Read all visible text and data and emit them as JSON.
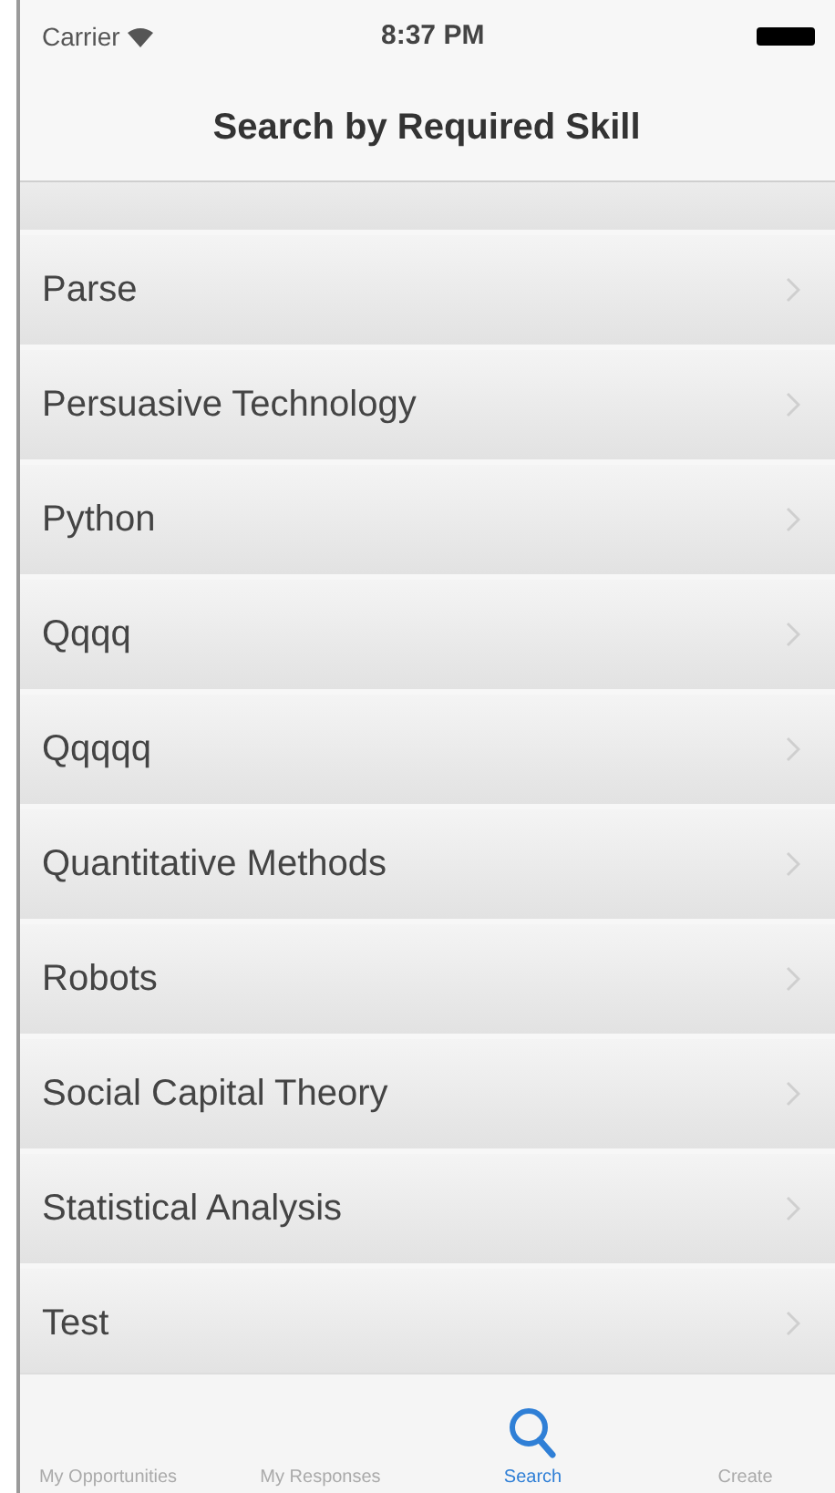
{
  "status_bar": {
    "carrier": "Carrier",
    "time": "8:37 PM"
  },
  "navigation_bar": {
    "title": "Search by Required Skill"
  },
  "skills": [
    {
      "label": "Parse"
    },
    {
      "label": "Persuasive Technology"
    },
    {
      "label": "Python"
    },
    {
      "label": "Qqqq"
    },
    {
      "label": "Qqqqq"
    },
    {
      "label": "Quantitative Methods"
    },
    {
      "label": "Robots"
    },
    {
      "label": "Social Capital Theory"
    },
    {
      "label": "Statistical Analysis"
    },
    {
      "label": "Test"
    }
  ],
  "tab_bar": [
    {
      "label": "My Opportunities",
      "selected": false
    },
    {
      "label": "My Responses",
      "selected": false
    },
    {
      "label": "Search",
      "selected": true
    },
    {
      "label": "Create",
      "selected": false
    }
  ]
}
